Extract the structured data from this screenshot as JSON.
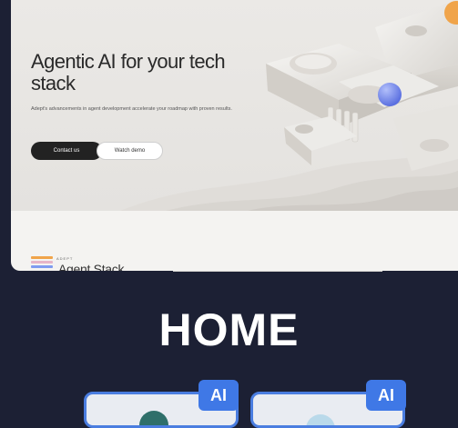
{
  "hero": {
    "title": "Agentic AI for your tech stack",
    "subtitle": "Adept's advancements in agent development accelerate your roadmap with proven results.",
    "primary_button": "Contact us",
    "secondary_button": "Watch demo"
  },
  "logo": {
    "brand": "ADEPT",
    "name": "Agent Stack"
  },
  "page_title": "HOME",
  "cards": [
    {
      "badge": "AI",
      "icon": "ai-app-icon"
    },
    {
      "badge": "AI",
      "icon": "ai-app-icon"
    }
  ],
  "colors": {
    "background": "#1c2034",
    "accent_blue": "#3f78e6",
    "sphere": "#6f86f2",
    "orange_accent": "#f0a44a"
  }
}
